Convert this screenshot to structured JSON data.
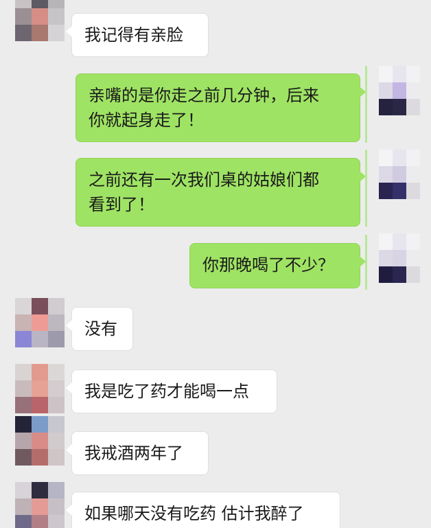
{
  "messages": [
    {
      "side": "in",
      "text": "我记得有亲脸"
    },
    {
      "side": "out",
      "text": "亲嘴的是你走之前几分钟，后来\n你就起身走了！"
    },
    {
      "side": "out",
      "text": "之前还有一次我们桌的姑娘们都\n看到了！"
    },
    {
      "side": "out",
      "text": "你那晚喝了不少？"
    },
    {
      "side": "in",
      "text": "没有"
    },
    {
      "side": "in",
      "text": "我是吃了药才能喝一点"
    },
    {
      "side": "in",
      "text": "我戒酒两年了"
    },
    {
      "side": "in",
      "text": "如果哪天没有吃药 估计我醉了"
    }
  ],
  "colors": {
    "background": "#ececec",
    "incoming_bubble": "#ffffff",
    "outgoing_bubble": "#9fe364"
  },
  "avatars": {
    "contact": "pixelated-contact-avatar",
    "self": "pixelated-self-avatar"
  }
}
